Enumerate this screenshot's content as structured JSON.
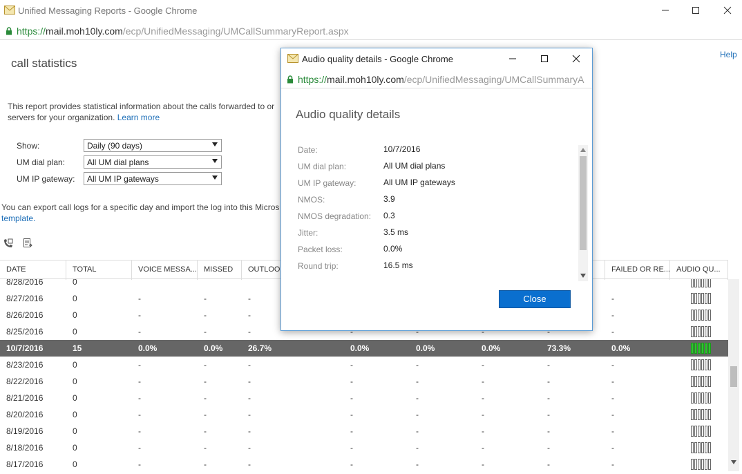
{
  "window": {
    "title": "Unified Messaging Reports - Google Chrome",
    "url_scheme": "https://",
    "url_host": "mail.moh10ly.com",
    "url_path": "/ecp/UnifiedMessaging/UMCallSummaryReport.aspx"
  },
  "header": {
    "help": "Help",
    "title": "call statistics"
  },
  "description": {
    "line1": "This report provides statistical information about the calls forwarded to or",
    "line2": "servers for your organization.",
    "learn_more": "Learn more"
  },
  "filters": [
    {
      "label": "Show:",
      "value": "Daily (90 days)"
    },
    {
      "label": "UM dial plan:",
      "value": "All UM dial plans"
    },
    {
      "label": "UM IP gateway:",
      "value": "All UM IP gateways"
    }
  ],
  "export": {
    "text": "You can export call logs for a specific day and import the log into this Micros",
    "link": "template."
  },
  "table": {
    "columns": [
      "DATE",
      "TOTAL",
      "VOICE MESSA...",
      "MISSED",
      "OUTLOOK",
      "",
      "",
      "",
      "",
      "FAILED OR RE...",
      "AUDIO QU..."
    ],
    "rows": [
      {
        "date": "8/28/2016",
        "total": "0",
        "c3": "",
        "c4": "",
        "c5": "",
        "c6": "",
        "c7": "",
        "c8": "",
        "c9": "",
        "c10": ""
      },
      {
        "date": "8/27/2016",
        "total": "0",
        "c3": "-",
        "c4": "-",
        "c5": "-",
        "c6": "-",
        "c7": "-",
        "c8": "-",
        "c9": "-",
        "c10": "-"
      },
      {
        "date": "8/26/2016",
        "total": "0",
        "c3": "-",
        "c4": "-",
        "c5": "-",
        "c6": "-",
        "c7": "-",
        "c8": "-",
        "c9": "-",
        "c10": "-"
      },
      {
        "date": "8/25/2016",
        "total": "0",
        "c3": "-",
        "c4": "-",
        "c5": "-",
        "c6": "-",
        "c7": "-",
        "c8": "-",
        "c9": "-",
        "c10": "-"
      },
      {
        "date": "10/7/2016",
        "total": "15",
        "c3": "0.0%",
        "c4": "0.0%",
        "c5": "26.7%",
        "c6": "0.0%",
        "c7": "0.0%",
        "c8": "0.0%",
        "c9": "73.3%",
        "c10": "0.0%"
      },
      {
        "date": "8/23/2016",
        "total": "0",
        "c3": "-",
        "c4": "-",
        "c5": "-",
        "c6": "-",
        "c7": "-",
        "c8": "-",
        "c9": "-",
        "c10": "-"
      },
      {
        "date": "8/22/2016",
        "total": "0",
        "c3": "-",
        "c4": "-",
        "c5": "-",
        "c6": "-",
        "c7": "-",
        "c8": "-",
        "c9": "-",
        "c10": "-"
      },
      {
        "date": "8/21/2016",
        "total": "0",
        "c3": "-",
        "c4": "-",
        "c5": "-",
        "c6": "-",
        "c7": "-",
        "c8": "-",
        "c9": "-",
        "c10": "-"
      },
      {
        "date": "8/20/2016",
        "total": "0",
        "c3": "-",
        "c4": "-",
        "c5": "-",
        "c6": "-",
        "c7": "-",
        "c8": "-",
        "c9": "-",
        "c10": "-"
      },
      {
        "date": "8/19/2016",
        "total": "0",
        "c3": "-",
        "c4": "-",
        "c5": "-",
        "c6": "-",
        "c7": "-",
        "c8": "-",
        "c9": "-",
        "c10": "-"
      },
      {
        "date": "8/18/2016",
        "total": "0",
        "c3": "-",
        "c4": "-",
        "c5": "-",
        "c6": "-",
        "c7": "-",
        "c8": "-",
        "c9": "-",
        "c10": "-"
      },
      {
        "date": "8/17/2016",
        "total": "0",
        "c3": "-",
        "c4": "-",
        "c5": "-",
        "c6": "-",
        "c7": "-",
        "c8": "-",
        "c9": "-",
        "c10": "-"
      }
    ],
    "selected_row": 4
  },
  "popup": {
    "title": "Audio quality details - Google Chrome",
    "url_scheme": "https://",
    "url_host": "mail.moh10ly.com",
    "url_path": "/ecp/UnifiedMessaging/UMCallSummaryA",
    "heading": "Audio quality details",
    "details": [
      {
        "label": "Date:",
        "value": "10/7/2016"
      },
      {
        "label": "UM dial plan:",
        "value": "All UM dial plans"
      },
      {
        "label": "UM IP gateway:",
        "value": "All UM IP gateways"
      },
      {
        "label": "NMOS:",
        "value": "3.9"
      },
      {
        "label": "NMOS degradation:",
        "value": "0.3"
      },
      {
        "label": "Jitter:",
        "value": "3.5 ms"
      },
      {
        "label": "Packet loss:",
        "value": "0.0%"
      },
      {
        "label": "Round trip:",
        "value": "16.5 ms"
      }
    ],
    "close": "Close"
  },
  "icons": [
    "mail-icon",
    "lock-icon",
    "minimize-icon",
    "maximize-icon",
    "close-icon",
    "phone-log-icon",
    "export-document-icon"
  ],
  "colors": {
    "accent": "#0a6fcf",
    "selected_row": "#666666",
    "audio_good": "#2fc32f",
    "link": "#1e6fb8"
  }
}
